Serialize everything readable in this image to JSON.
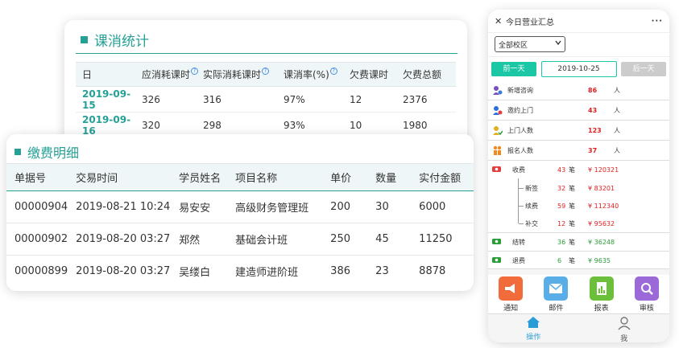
{
  "stats": {
    "title": "课消统计",
    "headers": [
      "日",
      "应消耗课时",
      "实际消耗课时",
      "课消率(%)",
      "欠费课时",
      "欠费总额"
    ],
    "help_mark": "?",
    "rows": [
      [
        "2019-09-15",
        "326",
        "316",
        "97%",
        "12",
        "2376"
      ],
      [
        "2019-09-16",
        "320",
        "298",
        "93%",
        "10",
        "1980"
      ]
    ]
  },
  "payments": {
    "title": "缴费明细",
    "headers": [
      "单据号",
      "交易时间",
      "学员姓名",
      "项目名称",
      "单价",
      "数量",
      "实付金额"
    ],
    "rows": [
      [
        "00000904",
        "2019-08-21 10:24",
        "易安安",
        "高级财务管理班",
        "200",
        "30",
        "6000"
      ],
      [
        "00000902",
        "2019-08-20 03:27",
        "郑然",
        "基础会计班",
        "250",
        "45",
        "11250"
      ],
      [
        "00000899",
        "2019-08-20 03:27",
        "吴缕白",
        "建造师进阶班",
        "386",
        "23",
        "8878"
      ]
    ]
  },
  "phone": {
    "close": "✕",
    "title": "今日营业汇总",
    "more": "···",
    "campus_select": "全部校区",
    "prev_day": "前一天",
    "date": "2019-10-25",
    "next_day": "后一天",
    "metrics": [
      {
        "label": "新增咨询",
        "value": "86",
        "unit": "人"
      },
      {
        "label": "邀约上门",
        "value": "43",
        "unit": "人"
      },
      {
        "label": "上门人数",
        "value": "123",
        "unit": "人"
      },
      {
        "label": "报名人数",
        "value": "37",
        "unit": "人"
      }
    ],
    "fee": {
      "label": "收费",
      "count": "43",
      "unit": "笔",
      "amount": "¥ 120321",
      "subs": [
        {
          "label": "新签",
          "count": "32",
          "unit": "笔",
          "amount": "¥ 83201"
        },
        {
          "label": "续费",
          "count": "59",
          "unit": "笔",
          "amount": "¥ 112340"
        },
        {
          "label": "补交",
          "count": "12",
          "unit": "笔",
          "amount": "¥ 95632"
        }
      ]
    },
    "carry": {
      "label": "结转",
      "count": "36",
      "unit": "笔",
      "amount": "¥ 36248"
    },
    "refund": {
      "label": "退费",
      "count": "6",
      "unit": "笔",
      "amount": "¥ 9635"
    },
    "actions": [
      "通知",
      "邮件",
      "报表",
      "审核"
    ],
    "tabs": [
      "操作",
      "我"
    ],
    "colors": {
      "accent": "#1cc7a6",
      "red": "#e02020",
      "green": "#2a9d3a",
      "teal": "#26a095"
    }
  }
}
